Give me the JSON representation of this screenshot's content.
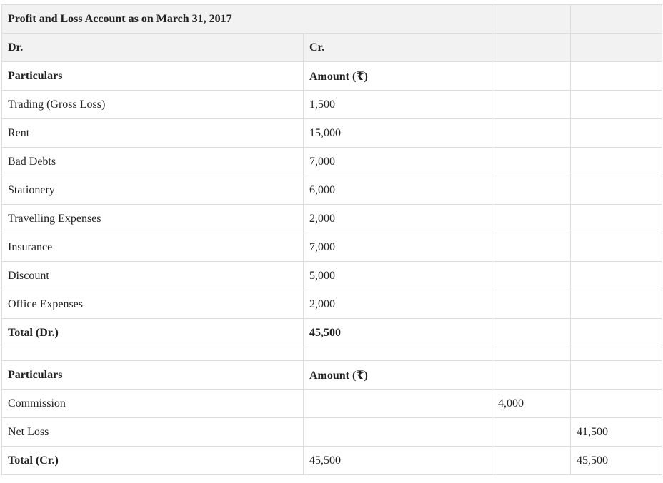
{
  "title": "Profit and Loss Account as on March 31, 2017",
  "header": {
    "dr": "Dr.",
    "cr": "Cr."
  },
  "debit_section": {
    "col_particulars": "Particulars",
    "col_amount": "Amount (₹)",
    "rows": [
      {
        "particular": "Trading (Gross Loss)",
        "amount": "1,500"
      },
      {
        "particular": "Rent",
        "amount": "15,000"
      },
      {
        "particular": "Bad Debts",
        "amount": "7,000"
      },
      {
        "particular": "Stationery",
        "amount": "6,000"
      },
      {
        "particular": "Travelling Expenses",
        "amount": "2,000"
      },
      {
        "particular": "Insurance",
        "amount": "7,000"
      },
      {
        "particular": "Discount",
        "amount": "5,000"
      },
      {
        "particular": "Office Expenses",
        "amount": "2,000"
      }
    ],
    "total_label": "Total (Dr.)",
    "total_amount": "45,500"
  },
  "credit_section": {
    "col_particulars": "Particulars",
    "col_amount": "Amount (₹)",
    "rows": [
      {
        "particular": "Commission",
        "col2": "",
        "col3": "4,000",
        "col4": ""
      },
      {
        "particular": "Net Loss",
        "col2": "",
        "col3": "",
        "col4": "41,500"
      }
    ],
    "total_label": "Total (Cr.)",
    "total_col2": "45,500",
    "total_col4": "45,500"
  }
}
